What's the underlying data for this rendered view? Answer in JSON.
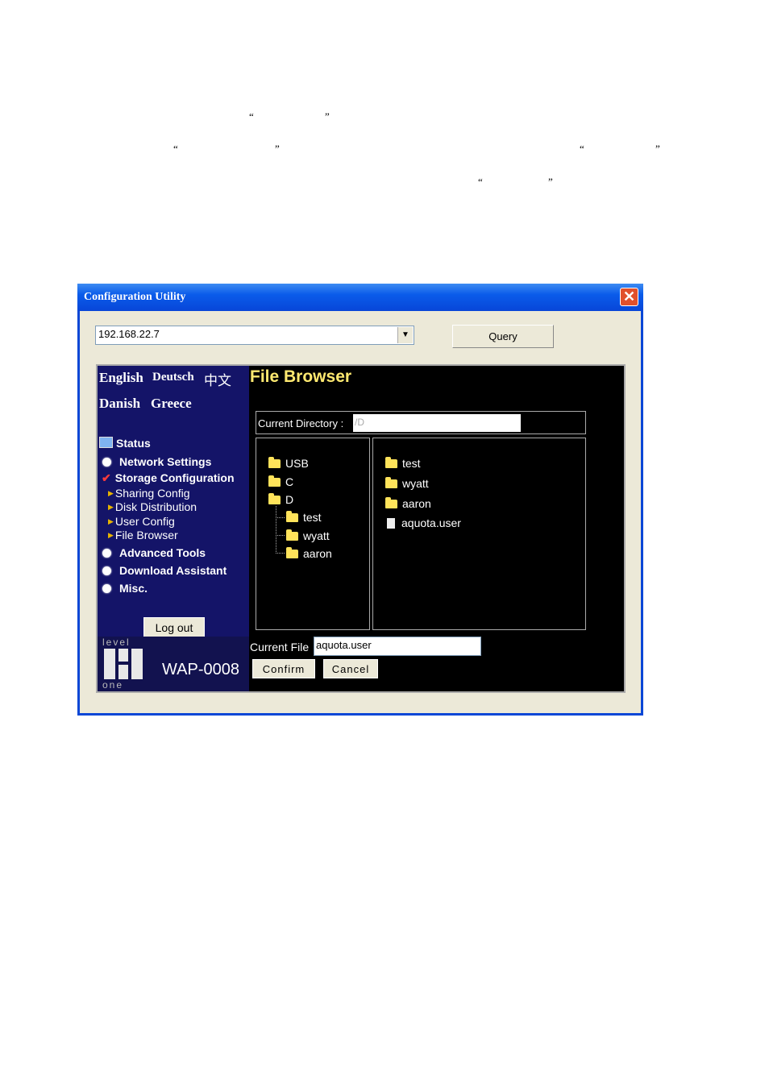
{
  "doc_quotes": {
    "q1_open": "“",
    "q1_close": "”",
    "q2_open": "“",
    "q2_close": "”",
    "q3_open": "“",
    "q3_close": "”",
    "q4_open": "“",
    "q4_close": "”"
  },
  "window": {
    "title": "Configuration Utility",
    "close_label": "✕"
  },
  "toolbar": {
    "address_value": "192.168.22.7",
    "dropdown_glyph": "▼",
    "query_label": "Query"
  },
  "languages": {
    "english": "English",
    "deutsch": "Deutsch",
    "chinese": "中文",
    "danish": "Danish",
    "greece": "Greece"
  },
  "menu": {
    "status": "Status",
    "network": "Network Settings",
    "storage": "Storage Configuration",
    "sub": [
      "Sharing Config",
      "Disk Distribution",
      "User Config",
      "File Browser"
    ],
    "advanced": "Advanced Tools",
    "download": "Download Assistant",
    "misc": "Misc.",
    "logout": "Log out"
  },
  "logo": {
    "top": "level",
    "bottom": "one",
    "model": "WAP-0008"
  },
  "file_browser": {
    "title": "File Browser",
    "current_dir_label": "Current Directory :",
    "current_dir_value": "/D",
    "tree": [
      "USB",
      "C",
      "D",
      "test",
      "wyatt",
      "aaron"
    ],
    "list": [
      "test",
      "wyatt",
      "aaron",
      "aquota.user"
    ],
    "current_file_label": "Current File",
    "current_file_value": "aquota.user",
    "confirm_label": "Confirm",
    "cancel_label": "Cancel"
  }
}
